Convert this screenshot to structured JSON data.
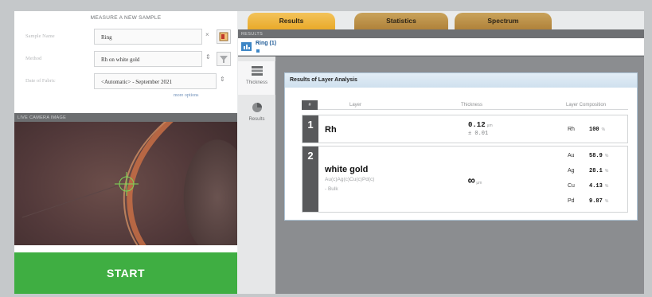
{
  "left_panel": {
    "measure_title": "MEASURE A NEW SAMPLE",
    "fields": [
      {
        "label": "Sample Name",
        "value": "Ring",
        "control": "×"
      },
      {
        "label": "Method",
        "value": "Rh on white gold",
        "control": "⇕"
      },
      {
        "label": "Date of Fabric",
        "value": "<Automatic> - September 2021",
        "control": "⇕"
      }
    ],
    "more_options": "more options",
    "camera_title": "LIVE CAMERA IMAGE",
    "start_label": "START"
  },
  "tabs": [
    {
      "label": "Results",
      "active": true
    },
    {
      "label": "Statistics",
      "active": false
    },
    {
      "label": "Spectrum",
      "active": false
    }
  ],
  "results_header": "RESULTS",
  "sample": {
    "name": "Ring (1)"
  },
  "side_nav": [
    {
      "label": "Thickness",
      "icon": "layers-icon",
      "active": true
    },
    {
      "label": "Results",
      "icon": "pie-chart-icon",
      "active": false
    }
  ],
  "analysis": {
    "title": "Results of Layer Analysis",
    "columns": {
      "num": "#",
      "layer": "Layer",
      "thickness": "Thickness",
      "composition": "Layer Composition"
    },
    "layers": [
      {
        "num": "1",
        "name": "Rh",
        "formula": "",
        "type": "",
        "thickness": "0.12",
        "thickness_unit": "µm",
        "tolerance": "± 0.01",
        "composition": [
          {
            "element": "Rh",
            "value": "100",
            "unit": "%"
          }
        ]
      },
      {
        "num": "2",
        "name": "white gold",
        "formula": "Au(c)Ag(c)Cu(c)Pd(c)",
        "type": "- Bulk",
        "thickness": "∞",
        "thickness_unit": "µm",
        "tolerance": "",
        "composition": [
          {
            "element": "Au",
            "value": "58.9",
            "unit": "%"
          },
          {
            "element": "Ag",
            "value": "28.1",
            "unit": "%"
          },
          {
            "element": "Cu",
            "value": "4.13",
            "unit": "%"
          },
          {
            "element": "Pd",
            "value": "9.87",
            "unit": "%"
          }
        ]
      }
    ]
  },
  "colors": {
    "start": "#3fae42",
    "tab_active": "#f0b43c",
    "accent": "#3d86c6"
  }
}
